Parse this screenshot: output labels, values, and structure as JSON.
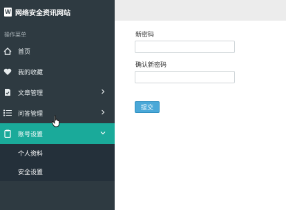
{
  "brand": {
    "title": "网络安全资讯网站",
    "logo_letter": "W"
  },
  "sidebar": {
    "section_label": "操作菜单",
    "items": [
      {
        "label": "首页",
        "icon": "home-icon"
      },
      {
        "label": "我的收藏",
        "icon": "heart-icon"
      },
      {
        "label": "文章管理",
        "icon": "document-check-icon",
        "arrow": "chevron-right-icon"
      },
      {
        "label": "问答管理",
        "icon": "list-icon",
        "arrow": "chevron-right-icon"
      },
      {
        "label": "账号设置",
        "icon": "clipboard-icon",
        "arrow": "chevron-down-icon",
        "active": true
      }
    ],
    "submenu": [
      {
        "label": "个人资料"
      },
      {
        "label": "安全设置"
      }
    ]
  },
  "form": {
    "new_password_label": "新密码",
    "new_password_value": "",
    "confirm_password_label": "确认新密码",
    "confirm_password_value": "",
    "submit_label": "提交"
  },
  "colors": {
    "sidebar_bg": "#2e3a41",
    "active_item_bg": "#1aaa9a",
    "submenu_bg": "#24303a",
    "submit_button_bg": "#4aa8d8"
  }
}
